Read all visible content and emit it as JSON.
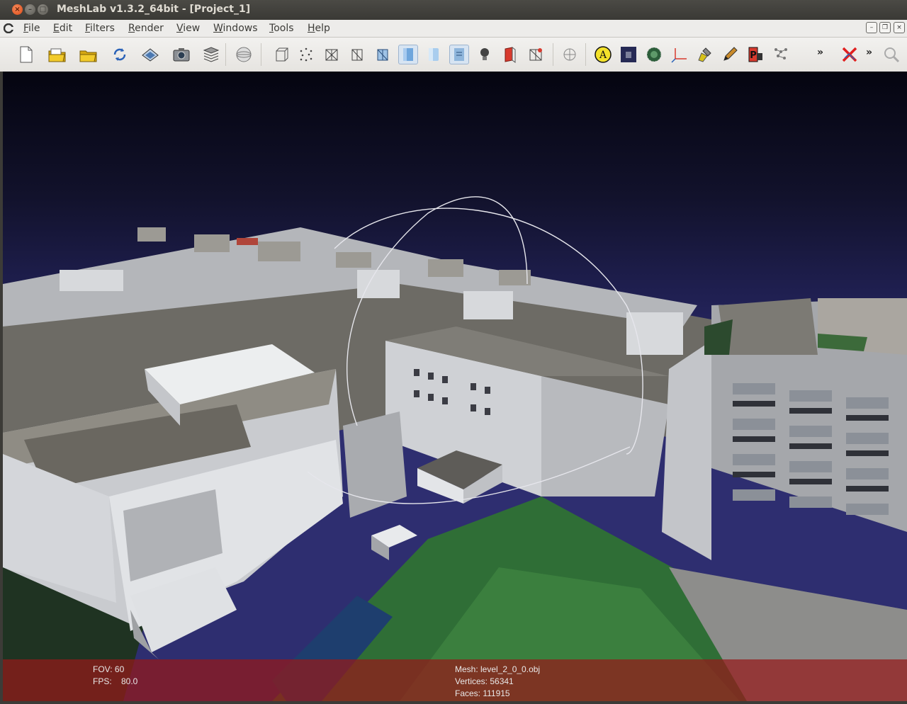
{
  "window": {
    "title": "MeshLab v1.3.2_64bit - [Project_1]"
  },
  "menu": {
    "file": "File",
    "edit": "Edit",
    "filters": "Filters",
    "render": "Render",
    "view": "View",
    "windows": "Windows",
    "tools": "Tools",
    "help": "Help"
  },
  "toolbar": {
    "overflow_1": "»",
    "overflow_2": "»",
    "icons": [
      "new-project-icon",
      "open-project-icon",
      "open-mesh-icon",
      "reload-icon",
      "save-icon",
      "snapshot-icon",
      "layers-icon",
      "trackball-icon",
      "bounding-box-icon",
      "points-icon",
      "wireframe-icon",
      "hidden-lines-icon",
      "flat-lines-icon",
      "flat-icon",
      "smooth-icon",
      "texture-icon",
      "light-icon",
      "double-side-icon",
      "fancy-lighting-icon",
      "axis-icon",
      "annotation-icon",
      "raster-icon",
      "sphere-icon",
      "align-axes-icon",
      "paint-icon",
      "pencil-icon",
      "pick-points-icon",
      "select-vertices-icon",
      "delete-icon",
      "search-icon"
    ]
  },
  "info": {
    "fov": "FOV: 60",
    "fps_label": "FPS:",
    "fps_value": "80.0",
    "mesh": "Mesh: level_2_0_0.obj",
    "vertices": "Vertices: 56341",
    "faces": "Faces: 111915"
  },
  "colors": {
    "titlebar": "#3c3b37",
    "close_button": "#df4a16",
    "info_overlay": "#961919",
    "sky_top": "#050510",
    "sky_bottom": "#2e2e70"
  }
}
